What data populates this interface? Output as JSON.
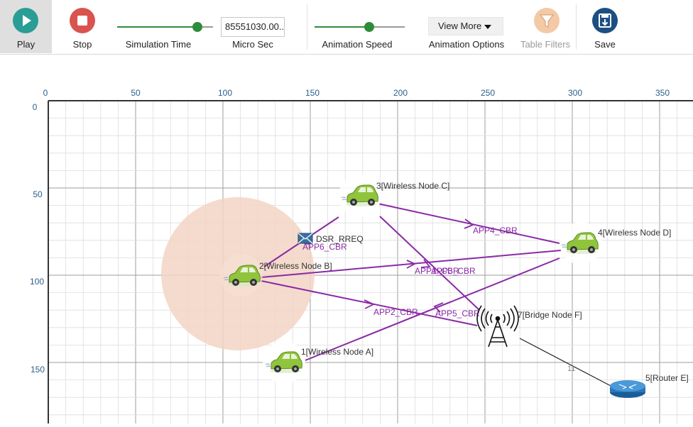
{
  "toolbar": {
    "play_label": "Play",
    "stop_label": "Stop",
    "sim_time_label": "Simulation Time",
    "sim_time_value": "85551030.00...",
    "micro_sec_label": "Micro Sec",
    "anim_speed_label": "Animation Speed",
    "view_more_label": "View More",
    "anim_options_label": "Animation Options",
    "table_filters_label": "Table Filters",
    "save_label": "Save",
    "sim_time_progress": 0.82,
    "anim_speed_progress": 0.61
  },
  "axes": {
    "x_ticks": [
      "0",
      "50",
      "100",
      "150",
      "200",
      "250",
      "300",
      "350"
    ],
    "y_ticks": [
      "0",
      "50",
      "100",
      "150"
    ]
  },
  "nodes": {
    "node_a": "1[Wireless Node A]",
    "node_b": "2[Wireless Node B]",
    "node_c": "3[Wireless Node C]",
    "node_d": "4[Wireless Node D]",
    "router_e": "5[Router E]",
    "bridge_f": "7[Bridge Node F]"
  },
  "links": {
    "app1": "APP1_CBR",
    "app2": "APP2_CBR",
    "app3": "APP3_CBR",
    "app4": "APP4_CBR",
    "app5": "APP5_CBR",
    "app6": "APP6_CBR",
    "wired_id": "11"
  },
  "packet": {
    "label": "DSR_RREQ"
  },
  "colors": {
    "play_teal": "#2a9d95",
    "stop_red": "#d9534f",
    "save_navy": "#1c4f82",
    "slider_green": "#2e8b3a",
    "flow_purple": "#8a2aa6",
    "axis_blue": "#2b5f8c",
    "range_peach": "#f3d5c4"
  }
}
